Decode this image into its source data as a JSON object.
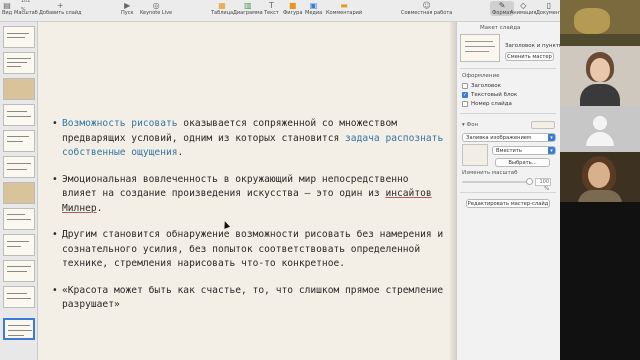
{
  "toolbar": {
    "zoom": "102 %",
    "items": [
      {
        "label": "Вид",
        "icon": "sidebar-icon"
      },
      {
        "label": "Масштаб",
        "icon": "zoom-icon"
      },
      {
        "label": "Добавить слайд",
        "icon": "plus-icon"
      },
      {
        "label": "Пуск",
        "icon": "play-icon"
      },
      {
        "label": "Keynote Live",
        "icon": "keynote-live-icon"
      },
      {
        "label": "Таблица",
        "icon": "table-icon"
      },
      {
        "label": "Диаграмма",
        "icon": "chart-icon"
      },
      {
        "label": "Текст",
        "icon": "text-icon"
      },
      {
        "label": "Фигура",
        "icon": "shape-icon"
      },
      {
        "label": "Медиа",
        "icon": "media-icon"
      },
      {
        "label": "Комментарий",
        "icon": "comment-icon"
      },
      {
        "label": "Совместная работа",
        "icon": "collaboration-icon"
      }
    ]
  },
  "inspector_tabs": [
    {
      "label": "Формат",
      "icon": "format-icon"
    },
    {
      "label": "Анимация",
      "icon": "animation-icon"
    },
    {
      "label": "Документ",
      "icon": "document-icon"
    }
  ],
  "inspector": {
    "layout_title": "Макет слайда",
    "layout_name": "Заголовок и пункты",
    "change_master_button": "Сменить мастер",
    "appearance_title": "Оформление",
    "checkboxes": [
      {
        "label": "Заголовок",
        "checked": false
      },
      {
        "label": "Текстовый блок",
        "checked": true
      },
      {
        "label": "Номер слайда",
        "checked": false
      }
    ],
    "background_title": "Фон",
    "background_fill": "Заливка изображением",
    "fit_mode": "Вместить",
    "choose_button": "Выбрать...",
    "scale_label": "Изменить масштаб",
    "scale_value": "100 %",
    "edit_master_button": "Редактировать мастер-слайд"
  },
  "slide": {
    "bullets": [
      {
        "parts": [
          {
            "text": "Возможность рисовать",
            "style": "hl"
          },
          {
            "text": " оказывается сопряженной со множеством предварящих условий, одним из которых становится ",
            "style": ""
          },
          {
            "text": "задача распознать собственные ощущения",
            "style": "hl"
          },
          {
            "text": ".",
            "style": ""
          }
        ]
      },
      {
        "parts": [
          {
            "text": "Эмоциональная вовлеченность в окружающий мир непосредственно влияет на создание произведения искусства – это один из ",
            "style": ""
          },
          {
            "text": "инсайтов",
            "style": "ul"
          },
          {
            "text": " ",
            "style": ""
          },
          {
            "text": "Милнер",
            "style": "ul"
          },
          {
            "text": ".",
            "style": ""
          }
        ]
      },
      {
        "parts": [
          {
            "text": "Другим становится обнаружение возможности рисовать без намерения и сознательного усилия, без попыток соответствовать определенной технике, стремления нарисовать что-то конкретное.",
            "style": ""
          }
        ]
      },
      {
        "parts": [
          {
            "text": "«Красота может быть как счастье, то, что слишком прямое стремление разрушает»",
            "style": ""
          }
        ]
      }
    ]
  },
  "colors": {
    "accent": "#3b7bd6",
    "highlight_text": "#3276a6",
    "slide_background": "#f4efe6"
  }
}
